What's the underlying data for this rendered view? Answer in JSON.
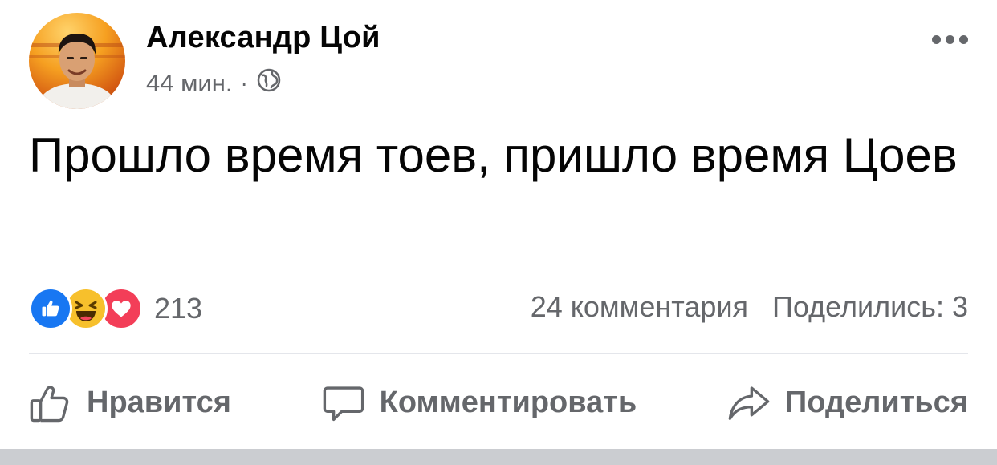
{
  "post": {
    "author": "Александр Цой",
    "time": "44 мин.",
    "separator": "·",
    "privacy_icon": "globe-icon",
    "more_icon": "more-options-icon",
    "text": "Прошло время тоев, пришло время Цоев"
  },
  "reactions": {
    "icons": [
      "like-icon",
      "haha-icon",
      "love-icon"
    ],
    "count": "213",
    "comments": "24 комментария",
    "shares": "Поделились: 3"
  },
  "actions": {
    "like": "Нравится",
    "comment": "Комментировать",
    "share": "Поделиться"
  },
  "colors": {
    "like_blue": "#1877f2",
    "haha_yellow": "#f7c02c",
    "love_red": "#f33e58",
    "secondary_text": "#65676b"
  }
}
